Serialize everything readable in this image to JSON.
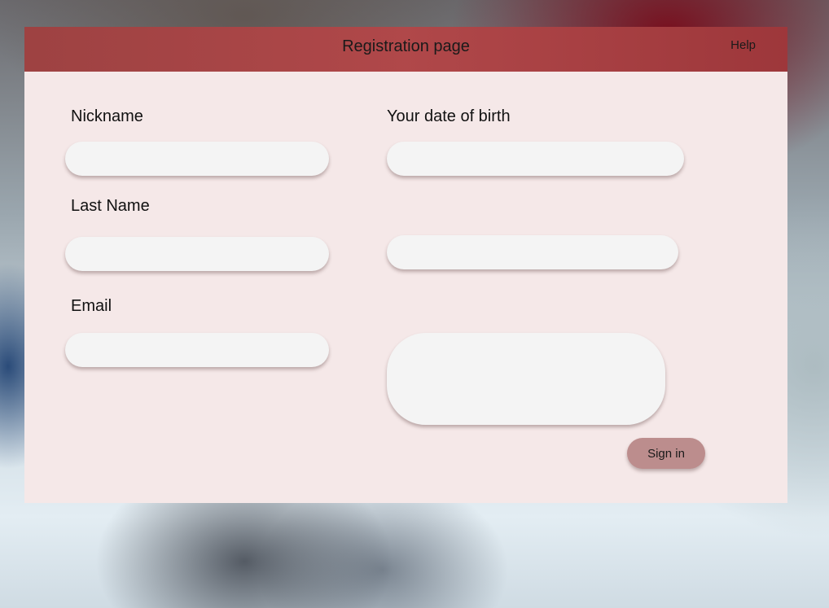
{
  "header": {
    "title": "Registration page",
    "help_label": "Help"
  },
  "form": {
    "nickname": {
      "label": "Nickname",
      "value": "",
      "placeholder": ""
    },
    "last_name": {
      "label": "Last Name",
      "value": "",
      "placeholder": ""
    },
    "email": {
      "label": "Email",
      "value": "",
      "placeholder": ""
    },
    "date_of_birth": {
      "label": "Your date of birth",
      "value": "",
      "placeholder": ""
    },
    "extra_field": {
      "value": "",
      "placeholder": ""
    },
    "message": {
      "value": "",
      "placeholder": ""
    }
  },
  "actions": {
    "sign_in_label": "Sign in"
  },
  "colors": {
    "titlebar": "#a63a3c",
    "panel": "#f5e8e8",
    "input": "#f4f4f4",
    "button": "#bc8d8d"
  }
}
